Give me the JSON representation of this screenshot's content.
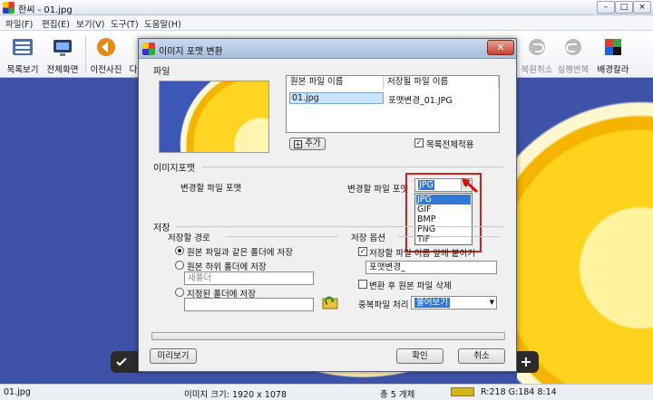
{
  "window": {
    "title": "한씨 - 01.jpg"
  },
  "menu": [
    "파일(F)",
    "편집(E)",
    "보기(V)",
    "도구(T)",
    "도움말(H)"
  ],
  "toolbar": {
    "list_view": "목록보기",
    "fullscreen": "전체화면",
    "prev_photo": "이전사진",
    "partial": "다",
    "undo": "복원취소",
    "redo": "실행반복",
    "bg_color": "배경칼라"
  },
  "dialog": {
    "title": "이미지 포맷 변환",
    "file_section": "파일",
    "col_original": "원본 파일 이름",
    "col_saved": "저장될 파일 이름",
    "row_original": "01.jpg",
    "row_saved": "포맷변경_01.JPG",
    "add_button": "추가",
    "apply_all": "목록전체적용",
    "format_section": "이미지포맷",
    "format_label_left": "변경할 파일 포맷",
    "format_label_right": "변경할 파일 포맷",
    "format_selected": "JPG",
    "format_options": [
      "JPG",
      "GIF",
      "BMP",
      "PNG",
      "TIF"
    ],
    "save_section": "저장",
    "save_path_group": "저장할 경로",
    "radio_same_folder": "원본 파일과 같은 폴더에 저장",
    "radio_sub_folder": "원본 하위 폴더에 저장",
    "sub_folder_placeholder": "새폴더",
    "radio_custom_folder": "지정된 폴더에 저장",
    "save_options_group": "저장 옵션",
    "prefix_checkbox": "저장할 파일 이름 앞에 붙이기",
    "prefix_value": "포맷변경_",
    "delete_original": "변환 후 원본 파일 삭제",
    "duplicate_label": "중복파일 처리",
    "duplicate_value": "물어보기",
    "preview_button": "미리보기",
    "ok_button": "확인",
    "cancel_button": "취소"
  },
  "status": {
    "filename": "01.jpg",
    "image_size": "이미지 크기: 1920 x 1078",
    "count": "총 5 개체",
    "color_readout": "R:218 G:184 8:14",
    "swatch_color": "#d3b41e"
  }
}
